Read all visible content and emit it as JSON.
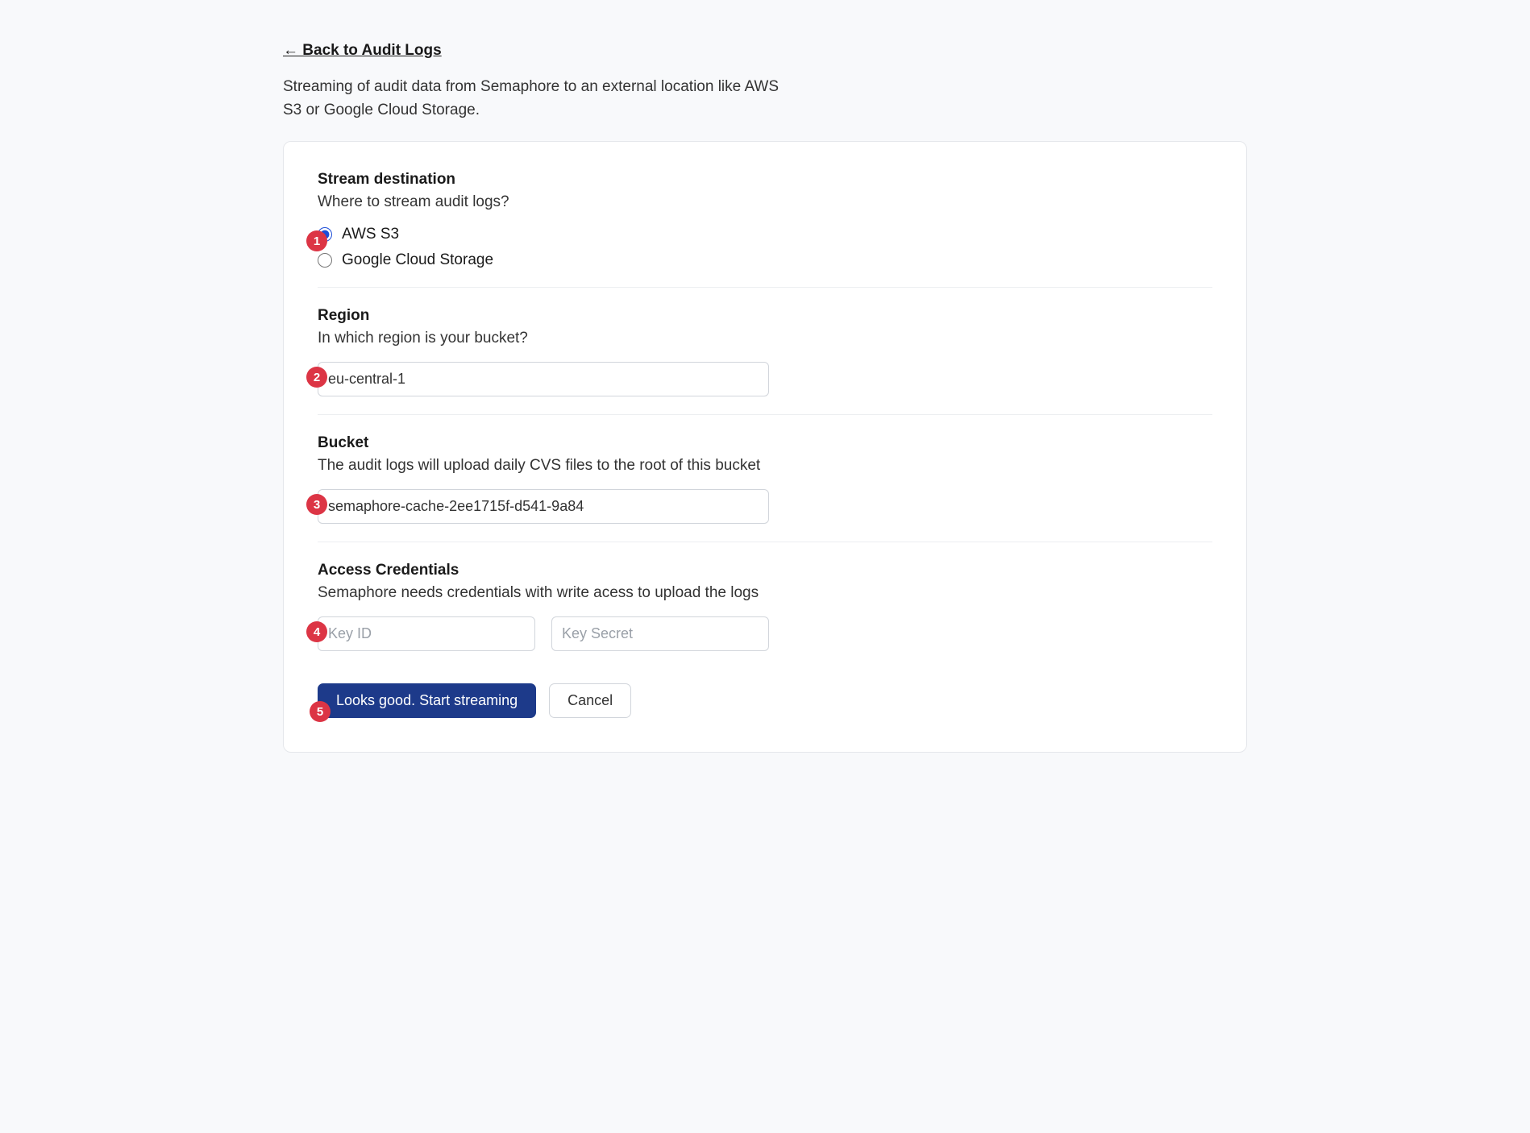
{
  "back_link": "← Back to Audit Logs",
  "intro": "Streaming of audit data from Semaphore to an external location like AWS S3 or Google Cloud Storage.",
  "dest": {
    "title": "Stream destination",
    "sub": "Where to stream audit logs?",
    "options": {
      "aws": "AWS S3",
      "gcs": "Google Cloud Storage"
    }
  },
  "region": {
    "title": "Region",
    "sub": "In which region is your bucket?",
    "value": "eu-central-1"
  },
  "bucket": {
    "title": "Bucket",
    "sub": "The audit logs will upload daily CVS files to the root of this bucket",
    "value": "semaphore-cache-2ee1715f-d541-9a84"
  },
  "creds": {
    "title": "Access Credentials",
    "sub": "Semaphore needs credentials with write acess to upload the logs",
    "key_id_placeholder": "Key ID",
    "key_secret_placeholder": "Key Secret"
  },
  "actions": {
    "start": "Looks good. Start streaming",
    "cancel": "Cancel"
  },
  "steps": {
    "s1": "1",
    "s2": "2",
    "s3": "3",
    "s4": "4",
    "s5": "5"
  }
}
